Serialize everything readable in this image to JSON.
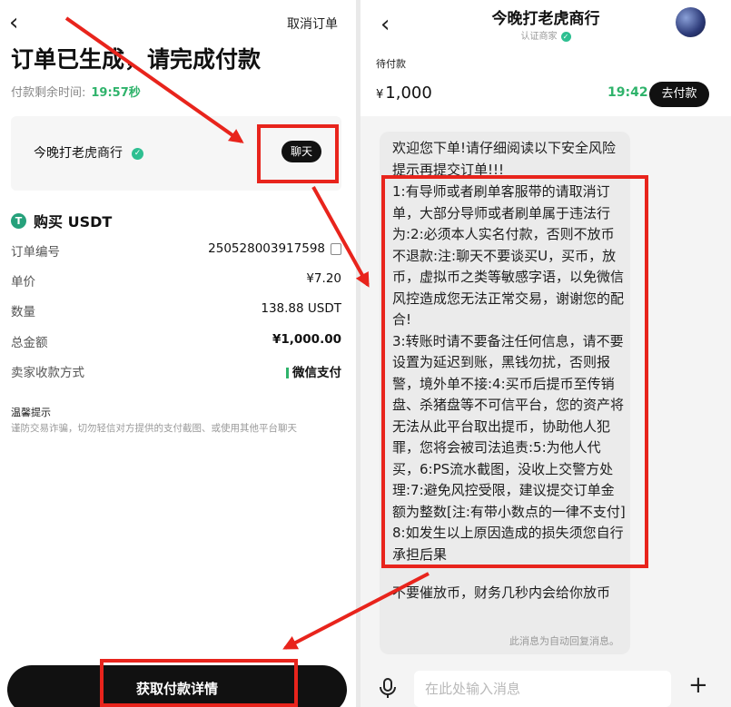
{
  "left": {
    "back_glyph": "‹",
    "cancel_order": "取消订单",
    "title": "订单已生成，请完成付款",
    "remaining_label": "付款剩余时间:",
    "remaining_time": "19:57秒",
    "merchant_name": "今晚打老虎商行",
    "chat_button": "聊天",
    "buy_label": "购买 USDT",
    "details": [
      {
        "label": "订单编号",
        "value": "250528003917598"
      },
      {
        "label": "单价",
        "value": "¥7.20"
      },
      {
        "label": "数量",
        "value": "138.88 USDT"
      },
      {
        "label": "总金额",
        "value": "¥1,000.00"
      },
      {
        "label": "卖家收款方式",
        "value": "微信支付"
      }
    ],
    "tips_title": "温馨提示",
    "tips_text": "谨防交易诈骗，切勿轻信对方提供的支付截图、或使用其他平台聊天",
    "get_payment_details": "获取付款详情"
  },
  "right": {
    "back_glyph": "‹",
    "merchant_name": "今晚打老虎商行",
    "merchant_sub": "认证商家",
    "pending_label": "待付款",
    "currency": "¥",
    "amount": "1,000",
    "timer": "19:42",
    "go_pay": "去付款",
    "message_intro": "欢迎您下单!请仔细阅读以下安全风险提示再提交订单!!!",
    "message_rules": [
      "1:有导师或者刷单客服带的请取消订单，大部分导师或者刷单属于违法行为:2:必须本人实名付款，否则不放币不退款:注:聊天不要谈买U，买币，放币，虚拟币之类等敏感字语，以免微信风控造成您无法正常交易，谢谢您的配合!",
      "3:转账时请不要备注任何信息，请不要设置为延迟到账，黑钱勿扰，否则报警，境外单不接:4:买币后提币至传销盘、杀猪盘等不可信平台，您的资产将无法从此平台取出提币，协助他人犯罪，您将会被司法追责:5:为他人代买，6:PS流水截图，没收上交警方处理:7:避免风控受限，建议提交订单金额为整数[注:有带小数点的一律不支付]",
      "8:如发生以上原因造成的损失须您自行承担后果"
    ],
    "message_end": "不要催放币，财务几秒内会给你放币",
    "auto_reply_note": "此消息为自动回复消息。",
    "input_placeholder": "在此处输入消息",
    "plus_glyph": "+"
  },
  "colors": {
    "annotation_red": "#e8241c",
    "accent_green": "#2fb36b",
    "button_black": "#111111"
  }
}
